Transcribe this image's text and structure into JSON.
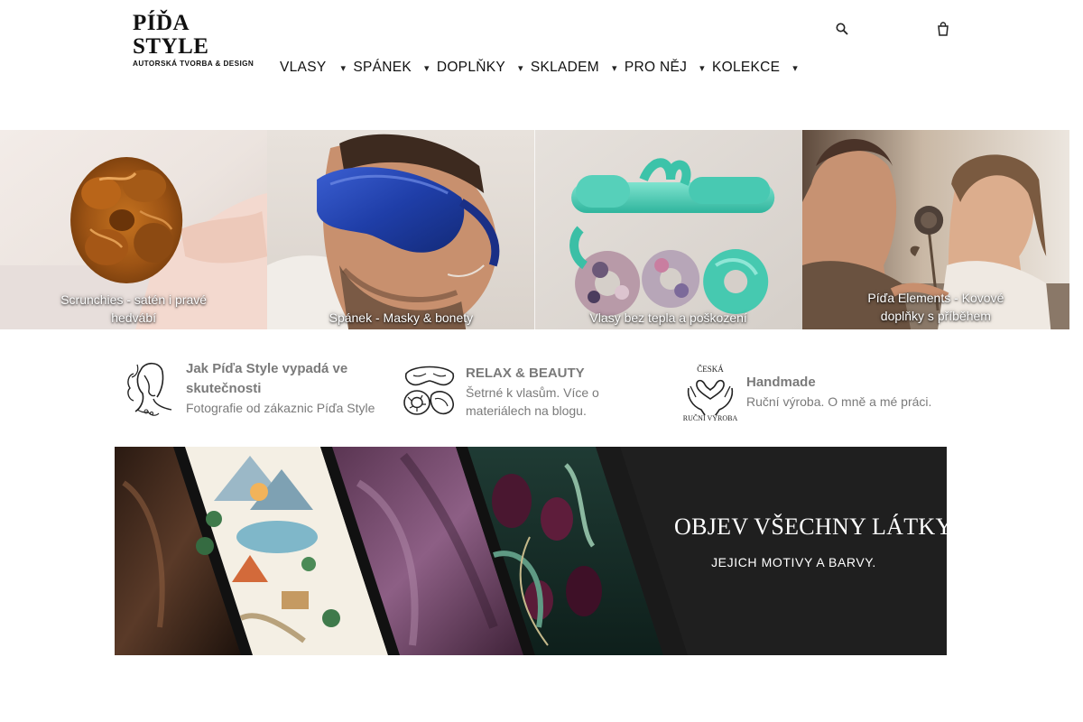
{
  "header": {
    "logo_title": "PÍĎA STYLE",
    "logo_subtitle": "AUTORSKÁ TVORBA & DESIGN",
    "search_icon": "search-icon",
    "cart_icon": "cart-icon"
  },
  "nav": {
    "items": [
      {
        "label": "VLASY",
        "caret": ""
      },
      {
        "label": "SPÁNEK",
        "caret": ""
      },
      {
        "label": "DOPLŇKY",
        "caret": ""
      },
      {
        "label": "SKLADEM",
        "caret": ""
      },
      {
        "label": "PRO NĚJ",
        "caret": ""
      },
      {
        "label": "KOLEKCE",
        "caret": ""
      }
    ]
  },
  "categories": [
    {
      "caption": "Scrunchies - satén i pravé hedvábí"
    },
    {
      "caption": "Spánek - Masky & bonety"
    },
    {
      "caption": "Vlasy bez tepla a poškození"
    },
    {
      "caption": "Píďa Elements - Kovové doplňky s příběhem"
    }
  ],
  "features": [
    {
      "title": "Jak Píďa Style vypadá ve skutečnosti",
      "description": "Fotografie od zákaznic Píďa Style",
      "icon": "woman-portrait-icon"
    },
    {
      "title": "RELAX & BEAUTY",
      "description": "Šetrné k vlasům. Více o materiálech na blogu.",
      "icon": "sleep-mask-scrunchie-icon"
    },
    {
      "title": "Handmade",
      "description": "Ruční výroba. O mně a mé práci.",
      "icon": "handmade-hands-heart-icon",
      "icon_text_top": "ČESKÁ",
      "icon_text_bottom": "RUČNÍ VÝROBA"
    }
  ],
  "banner": {
    "title": "OBJEV VŠECHNY LÁTKY",
    "subtitle": "JEJICH MOTIVY A BARVY."
  },
  "colors": {
    "text": "#111111",
    "muted": "#7a7a7a",
    "banner_dark": "#1f1f1f"
  }
}
